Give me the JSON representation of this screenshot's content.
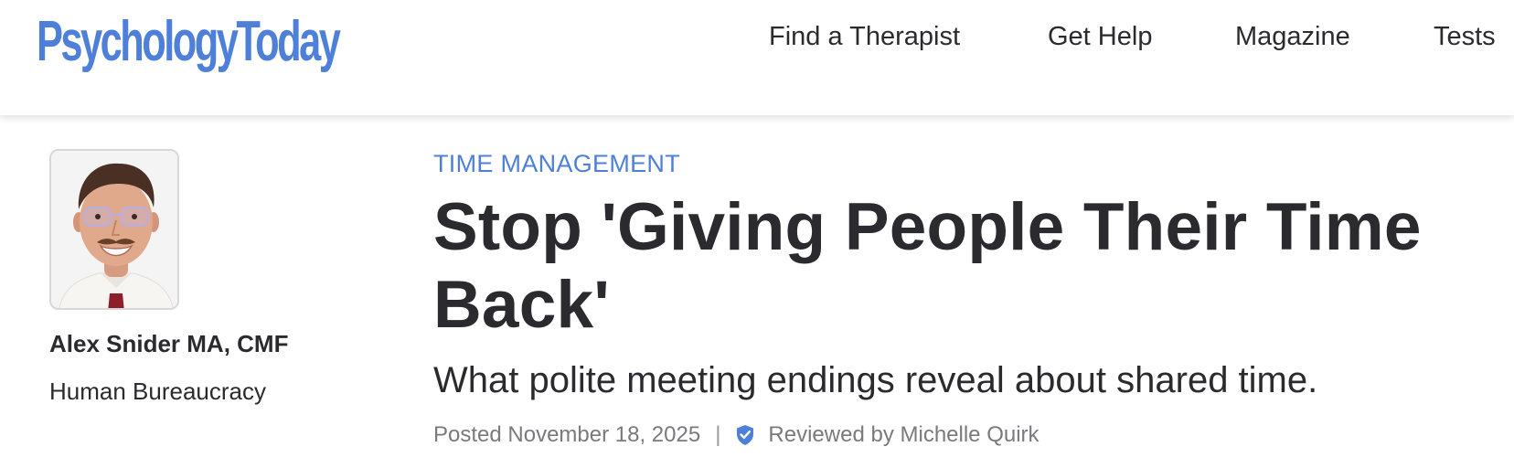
{
  "header": {
    "logo_text": "PsychologyToday",
    "nav": [
      {
        "label": "Find a Therapist"
      },
      {
        "label": "Get Help"
      },
      {
        "label": "Magazine"
      },
      {
        "label": "Tests"
      }
    ]
  },
  "author": {
    "name": "Alex Snider MA, CMF",
    "blog": "Human Bureaucracy"
  },
  "article": {
    "category": "TIME MANAGEMENT",
    "title": "Stop 'Giving People Their Time Back'",
    "subtitle": "What polite meeting endings reveal about shared time.",
    "posted": "Posted November 18, 2025",
    "separator": "|",
    "reviewed": "Reviewed by Michelle Quirk"
  },
  "colors": {
    "brand_blue": "#4f80d9",
    "text_dark": "#2b2b2f",
    "meta_gray": "#7a7a7e"
  },
  "icons": [
    "author-photo",
    "verified-shield-icon"
  ]
}
